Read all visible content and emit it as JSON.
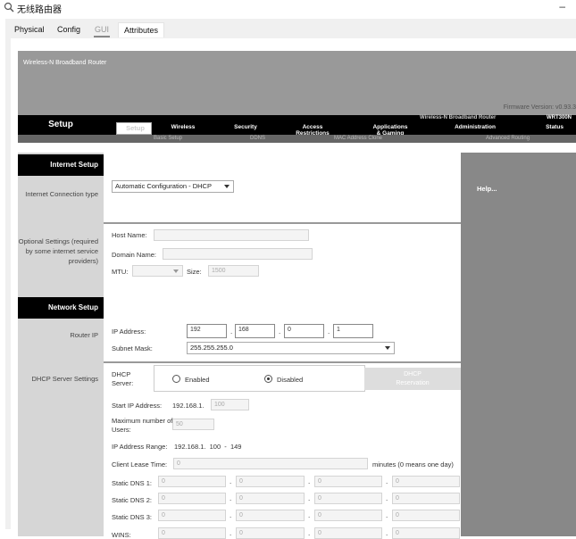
{
  "window": {
    "title": "无线路由器",
    "minimize": "–"
  },
  "tabs": [
    {
      "label": "Physical"
    },
    {
      "label": "Config"
    },
    {
      "label": "GUI"
    },
    {
      "label": "Attributes"
    }
  ],
  "header": {
    "brand": "Wireless-N Broadband Router",
    "firmware": "Firmware Version: v0.93.3",
    "model_name": "Wireless-N Broadband Router",
    "model_no": "WRT300N",
    "section": "Setup"
  },
  "nav": [
    {
      "label": "Setup"
    },
    {
      "label": "Wireless"
    },
    {
      "label": "Security"
    },
    {
      "label": "Access\nRestrictions"
    },
    {
      "label": "Applications\n& Gaming"
    },
    {
      "label": "Administration"
    },
    {
      "label": "Status"
    }
  ],
  "subnav": [
    "Basic Setup",
    "DDNS",
    "MAC Address Clone",
    "Advanced Routing"
  ],
  "help": "Help...",
  "internet_setup": {
    "heading": "Internet Setup",
    "conn_label": "Internet Connection type",
    "conn_value": "Automatic Configuration - DHCP"
  },
  "optional": {
    "label": "Optional Settings (required by some internet service providers)",
    "host_label": "Host Name:",
    "host_value": "",
    "domain_label": "Domain Name:",
    "domain_value": "",
    "mtu_label": "MTU:",
    "mtu_value": "",
    "size_label": "Size:",
    "size_value": "1500"
  },
  "network_setup": {
    "heading": "Network Setup",
    "router_ip_label": "Router IP",
    "ip_label": "IP Address:",
    "ip": [
      "192",
      "168",
      "0",
      "1"
    ],
    "mask_label": "Subnet Mask:",
    "mask_value": "255.255.255.0"
  },
  "dhcp": {
    "label": "DHCP Server Settings",
    "server_label": "DHCP Server:",
    "enabled": "Enabled",
    "disabled": "Disabled",
    "selected": "Disabled",
    "reservation": "DHCP Reservation",
    "start_label": "Start IP Address:",
    "start_prefix": "192.168.1.",
    "start_value": "100",
    "max_label": "Maximum number of Users:",
    "max_value": "50",
    "range_label": "IP Address Range:",
    "range_value": "192.168.1.  100  -  149",
    "lease_label": "Client Lease Time:",
    "lease_value": "0",
    "lease_suffix": "minutes (0 means one day)",
    "dns": [
      {
        "label": "Static DNS 1:",
        "values": [
          "0",
          "0",
          "0",
          "0"
        ]
      },
      {
        "label": "Static DNS 2:",
        "values": [
          "0",
          "0",
          "0",
          "0"
        ]
      },
      {
        "label": "Static DNS 3:",
        "values": [
          "0",
          "0",
          "0",
          "0"
        ]
      },
      {
        "label": "WINS:",
        "values": [
          "0",
          "0",
          "0",
          "0"
        ]
      }
    ]
  }
}
